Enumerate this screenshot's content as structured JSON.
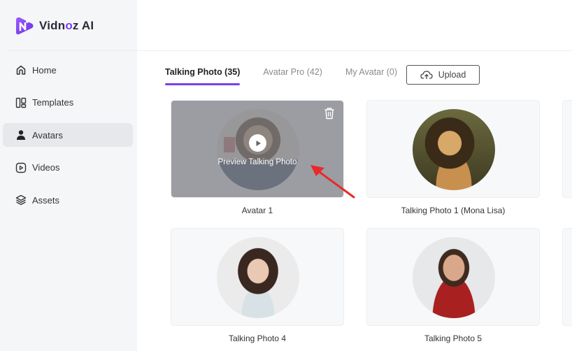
{
  "app": {
    "logo_text_a": "Vidn",
    "logo_text_o": "o",
    "logo_text_b": "z AI"
  },
  "sidebar": {
    "items": [
      {
        "label": "Home",
        "icon": "home-icon",
        "active": false
      },
      {
        "label": "Templates",
        "icon": "templates-icon",
        "active": false
      },
      {
        "label": "Avatars",
        "icon": "avatar-icon",
        "active": true
      },
      {
        "label": "Videos",
        "icon": "video-icon",
        "active": false
      },
      {
        "label": "Assets",
        "icon": "layers-icon",
        "active": false
      }
    ]
  },
  "tabs": [
    {
      "label": "Talking Photo (35)",
      "active": true
    },
    {
      "label": "Avatar Pro (42)",
      "active": false
    },
    {
      "label": "My Avatar (0)",
      "active": false
    }
  ],
  "upload_label": "Upload",
  "accent_color": "#7b3ff2",
  "cards": [
    {
      "label": "Avatar 1",
      "hovered": true,
      "preview_text": "Preview Talking Photo"
    },
    {
      "label": "Talking Photo 1 (Mona Lisa)",
      "hovered": false
    },
    {
      "label": "Talking Photo 4",
      "hovered": false
    },
    {
      "label": "Talking Photo 5",
      "hovered": false
    }
  ]
}
